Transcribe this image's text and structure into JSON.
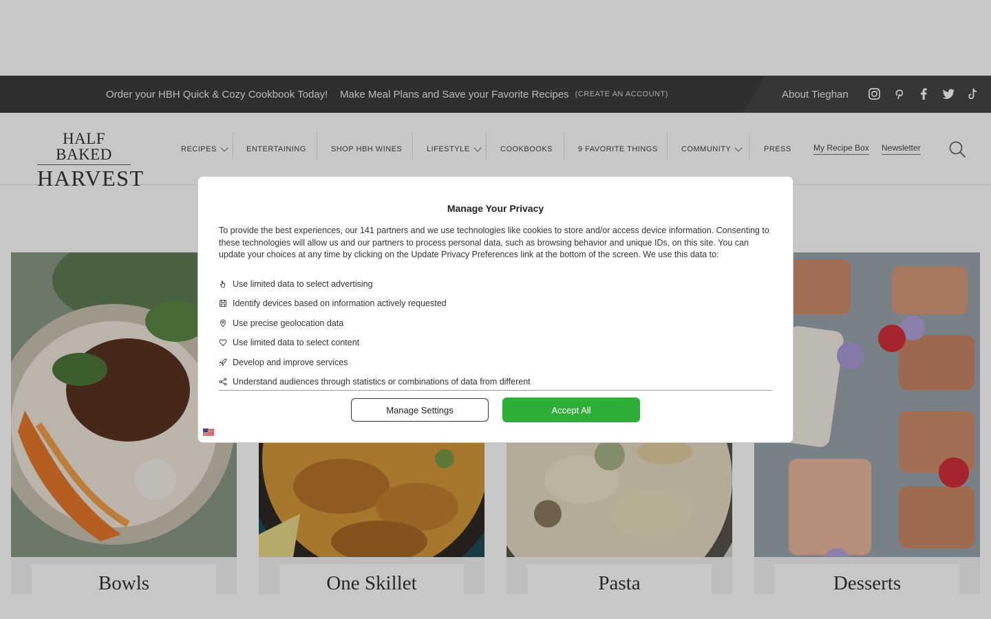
{
  "topbar": {
    "promo_cookbook": "Order your HBH Quick & Cozy Cookbook Today!",
    "promo_mealplans": "Make Meal Plans and Save your Favorite Recipes",
    "create_account": "(CREATE AN ACCOUNT)",
    "about": "About Tieghan",
    "social": [
      "instagram-icon",
      "pinterest-icon",
      "facebook-icon",
      "twitter-icon",
      "tiktok-icon"
    ]
  },
  "logo": {
    "line1": "HALF BAKED",
    "line2": "HARVEST"
  },
  "nav": {
    "recipes": "RECIPES",
    "entertaining": "ENTERTAINING",
    "shop_wines": "SHOP HBH WINES",
    "lifestyle": "LIFESTYLE",
    "cookbooks": "COOKBOOKS",
    "favorite_things": "9 FAVORITE THINGS",
    "community": "COMMUNITY",
    "press": "PRESS"
  },
  "header_links": {
    "recipe_box": "My Recipe Box",
    "newsletter": "Newsletter"
  },
  "tiles": [
    {
      "label": "Bowls"
    },
    {
      "label": "One Skillet"
    },
    {
      "label": "Pasta"
    },
    {
      "label": "Desserts"
    }
  ],
  "privacy": {
    "title": "Manage Your Privacy",
    "intro": "To provide the best experiences, our 141 partners and we use technologies like cookies to store and/or access device information. Consenting to these technologies will allow us and our partners to process personal data, such as browsing behavior and unique IDs, on this site. You can update your choices at any time by clicking on the Update Privacy Preferences link at the bottom of the screen. We use this data to:",
    "purposes": [
      {
        "icon": "hand-pointer-icon",
        "text": "Use limited data to select advertising"
      },
      {
        "icon": "device-save-icon",
        "text": "Identify devices based on information actively requested"
      },
      {
        "icon": "map-pin-icon",
        "text": "Use precise geolocation data"
      },
      {
        "icon": "heart-icon",
        "text": "Use limited data to select content"
      },
      {
        "icon": "rocket-icon",
        "text": "Develop and improve services"
      },
      {
        "icon": "share-icon",
        "text": "Understand audiences through statistics or combinations of data from different"
      }
    ],
    "manage_label": "Manage Settings",
    "accept_label": "Accept All"
  },
  "colors": {
    "accept": "#2eb038",
    "topbar": "#3d3d3d"
  }
}
